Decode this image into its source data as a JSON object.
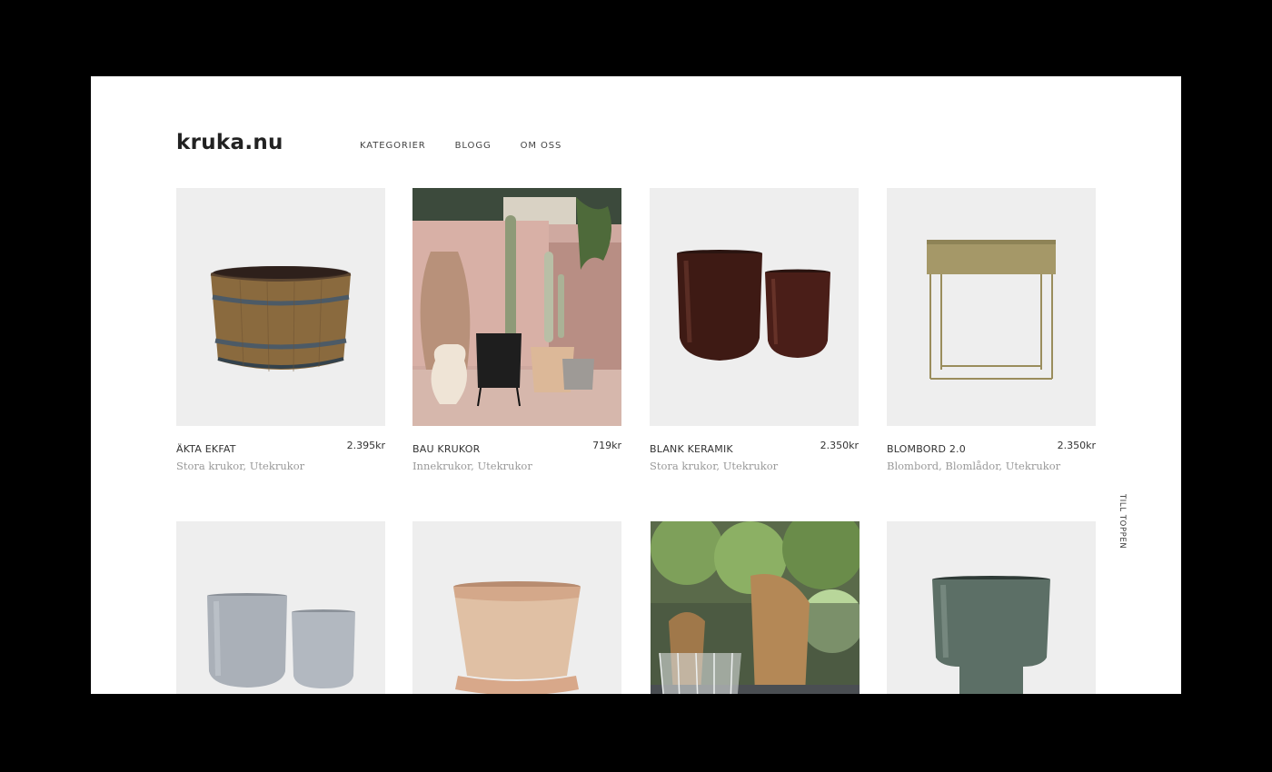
{
  "brand": {
    "logo": "kruka.nu"
  },
  "nav": {
    "items": [
      "KATEGORIER",
      "BLOGG",
      "OM OSS"
    ]
  },
  "products": [
    {
      "name": "ÄKTA EKFAT",
      "price": "2.395kr",
      "categories": "Stora krukor, Utekrukor",
      "image": "oak-barrel-pot"
    },
    {
      "name": "BAU KRUKOR",
      "price": "719kr",
      "categories": "Innekrukor, Utekrukor",
      "image": "pots-with-cactus-scene"
    },
    {
      "name": "BLANK KERAMIK",
      "price": "2.350kr",
      "categories": "Stora krukor, Utekrukor",
      "image": "glossy-brown-ceramic-pots"
    },
    {
      "name": "BLOMBORD 2.0",
      "price": "2.350kr",
      "categories": "Blombord, Blomlådor, Utekrukor",
      "image": "brass-plant-stand"
    },
    {
      "name": "",
      "price": "",
      "categories": "",
      "image": "grey-concrete-pots"
    },
    {
      "name": "",
      "price": "",
      "categories": "",
      "image": "terracotta-pot-with-saucer"
    },
    {
      "name": "",
      "price": "",
      "categories": "",
      "image": "wire-basket-garden-scene"
    },
    {
      "name": "",
      "price": "",
      "categories": "",
      "image": "green-glazed-pot"
    }
  ],
  "side": {
    "to_top": "TILL TOPPEN"
  },
  "colors": {
    "page_bg": "#ffffff",
    "card_bg": "#eeeeee",
    "frame": "#000000"
  }
}
